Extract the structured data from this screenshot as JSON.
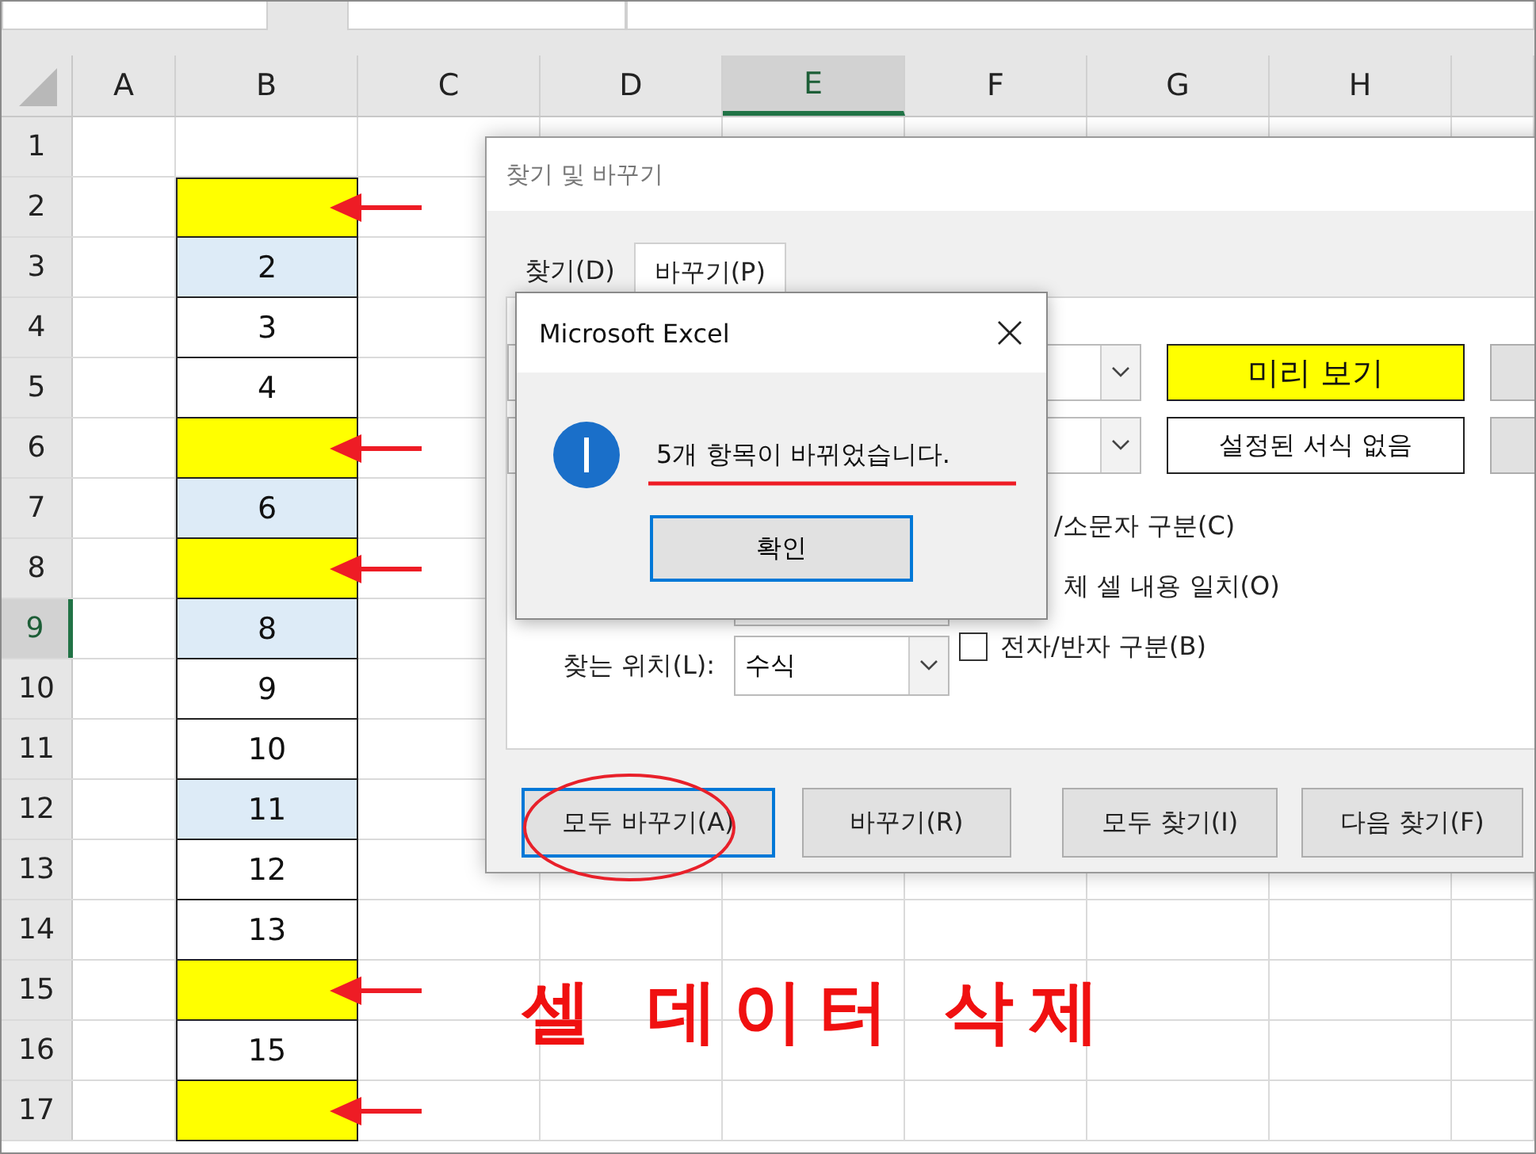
{
  "sheet": {
    "columns": [
      {
        "label": "A",
        "selected": false
      },
      {
        "label": "B",
        "selected": false
      },
      {
        "label": "C",
        "selected": false
      },
      {
        "label": "D",
        "selected": false
      },
      {
        "label": "E",
        "selected": true
      },
      {
        "label": "F",
        "selected": false
      },
      {
        "label": "G",
        "selected": false
      },
      {
        "label": "H",
        "selected": false
      }
    ],
    "rows": [
      {
        "number": "1",
        "selected": false,
        "arrow": false,
        "b": null
      },
      {
        "number": "2",
        "selected": false,
        "arrow": true,
        "b": {
          "color": "#ffff00"
        }
      },
      {
        "number": "3",
        "selected": false,
        "arrow": false,
        "b": {
          "text": "2",
          "color": "#ddebf7"
        }
      },
      {
        "number": "4",
        "selected": false,
        "arrow": false,
        "b": {
          "text": "3",
          "color": "#ffffff"
        }
      },
      {
        "number": "5",
        "selected": false,
        "arrow": false,
        "b": {
          "text": "4",
          "color": "#ffffff"
        }
      },
      {
        "number": "6",
        "selected": false,
        "arrow": true,
        "b": {
          "color": "#ffff00"
        }
      },
      {
        "number": "7",
        "selected": false,
        "arrow": false,
        "b": {
          "text": "6",
          "color": "#ddebf7"
        }
      },
      {
        "number": "8",
        "selected": false,
        "arrow": true,
        "b": {
          "color": "#ffff00"
        }
      },
      {
        "number": "9",
        "selected": true,
        "arrow": false,
        "b": {
          "text": "8",
          "color": "#ddebf7"
        }
      },
      {
        "number": "10",
        "selected": false,
        "arrow": false,
        "b": {
          "text": "9",
          "color": "#ffffff"
        }
      },
      {
        "number": "11",
        "selected": false,
        "arrow": false,
        "b": {
          "text": "10",
          "color": "#ffffff"
        }
      },
      {
        "number": "12",
        "selected": false,
        "arrow": false,
        "b": {
          "text": "11",
          "color": "#ddebf7"
        }
      },
      {
        "number": "13",
        "selected": false,
        "arrow": false,
        "b": {
          "text": "12",
          "color": "#ffffff"
        }
      },
      {
        "number": "14",
        "selected": false,
        "arrow": false,
        "b": {
          "text": "13",
          "color": "#ffffff"
        }
      },
      {
        "number": "15",
        "selected": false,
        "arrow": true,
        "b": {
          "color": "#ffff00"
        }
      },
      {
        "number": "16",
        "selected": false,
        "arrow": false,
        "b": {
          "text": "15",
          "color": "#ffffff"
        }
      },
      {
        "number": "17",
        "selected": false,
        "arrow": true,
        "b": {
          "color": "#ffff00"
        }
      }
    ]
  },
  "dialog": {
    "title": "찾기 및 바꾸기",
    "tabs": [
      {
        "label": "찾기(D)",
        "selected": false
      },
      {
        "label": "바꾸기(P)",
        "selected": true
      }
    ],
    "preview_button": "미리 보기",
    "format_button": "설정된 서식 없음",
    "options_partial": [
      "/소문자 구분(C)",
      "체 셀 내용 일치(O)"
    ],
    "options": [
      {
        "label": "전자/반자 구분(B)",
        "checked": false
      }
    ],
    "search_in": {
      "label": "찾는 위치(L):",
      "value": "수식"
    },
    "buttons": [
      {
        "label": "모두 바꾸기(A)",
        "focused": true
      },
      {
        "label": "바꾸기(R)",
        "focused": false
      },
      {
        "label": "모두 찾기(I)",
        "focused": false
      },
      {
        "label": "다음 찾기(F)",
        "focused": false
      }
    ]
  },
  "message_box": {
    "title": "Microsoft Excel",
    "message": "5개 항목이 바뀌었습니다.",
    "ok_button": "확인"
  },
  "annotation": {
    "caption": "셀 데이터 삭제"
  }
}
